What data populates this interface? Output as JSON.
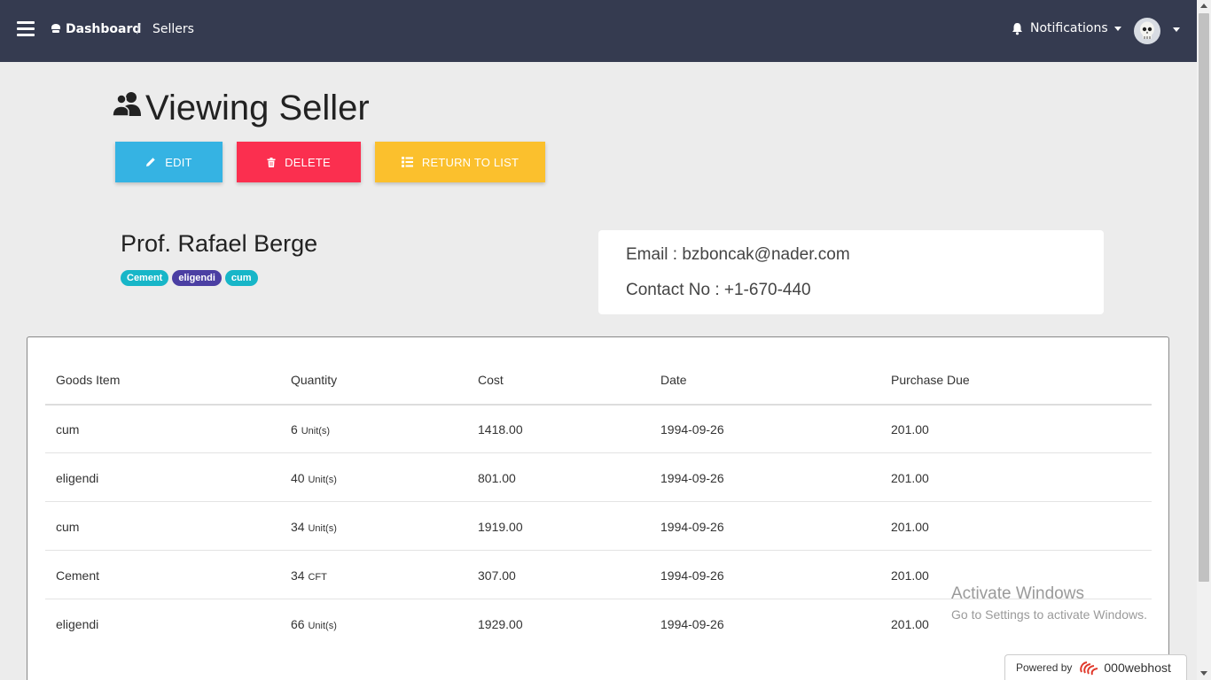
{
  "header": {
    "breadcrumb_root": "Dashboard",
    "breadcrumb_sep": "/",
    "breadcrumb_current": "Sellers",
    "notifications_label": "Notifications"
  },
  "page": {
    "title": "Viewing Seller",
    "buttons": {
      "edit": "EDIT",
      "delete": "DELETE",
      "return": "RETURN TO LIST"
    }
  },
  "seller": {
    "name": "Prof. Rafael Berge",
    "tags": [
      "Cement",
      "eligendi",
      "cum"
    ],
    "email_line": "Email : bzboncak@nader.com",
    "contact_line": "Contact No : +1-670-440"
  },
  "table": {
    "headers": [
      "Goods Item",
      "Quantity",
      "Cost",
      "Date",
      "Purchase Due"
    ],
    "rows": [
      {
        "item": "cum",
        "qty": "6",
        "unit": "Unit(s)",
        "cost": "1418.00",
        "date": "1994-09-26",
        "due": "201.00"
      },
      {
        "item": "eligendi",
        "qty": "40",
        "unit": "Unit(s)",
        "cost": "801.00",
        "date": "1994-09-26",
        "due": "201.00"
      },
      {
        "item": "cum",
        "qty": "34",
        "unit": "Unit(s)",
        "cost": "1919.00",
        "date": "1994-09-26",
        "due": "201.00"
      },
      {
        "item": "Cement",
        "qty": "34",
        "unit": "CFT",
        "cost": "307.00",
        "date": "1994-09-26",
        "due": "201.00"
      },
      {
        "item": "eligendi",
        "qty": "66",
        "unit": "Unit(s)",
        "cost": "1929.00",
        "date": "1994-09-26",
        "due": "201.00"
      }
    ]
  },
  "watermark": {
    "title": "Activate Windows",
    "subtitle": "Go to Settings to activate Windows."
  },
  "powered": {
    "label": "Powered by",
    "brand": "000webhost"
  },
  "colors": {
    "topbar": "#353b50",
    "edit": "#35b3e3",
    "delete": "#fb2f4f",
    "return": "#fbc02d",
    "tag_cyan": "#17b6c8",
    "tag_indigo": "#4b3fa3"
  }
}
